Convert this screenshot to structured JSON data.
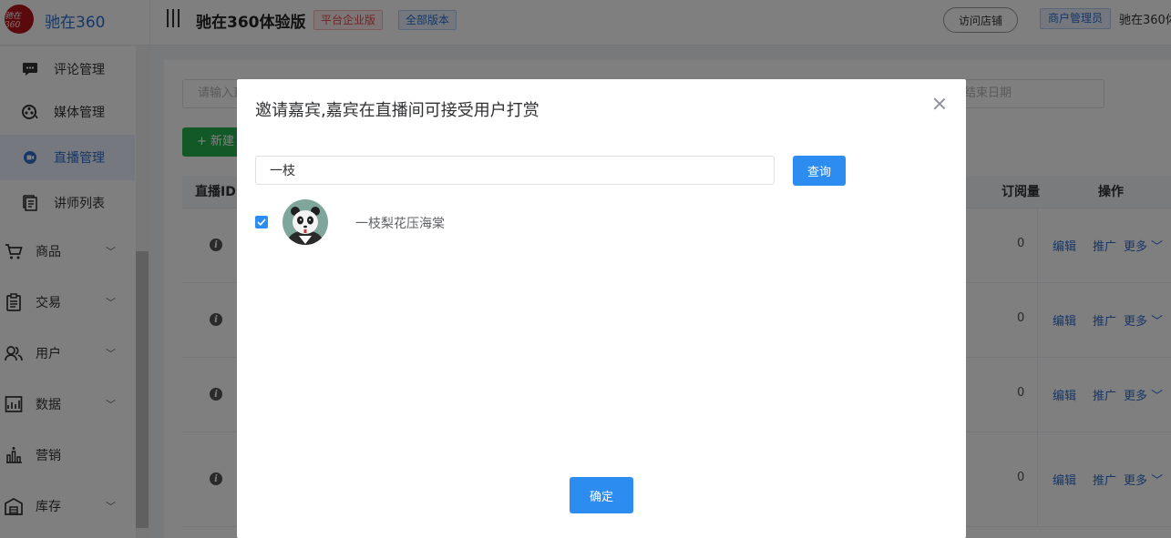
{
  "header": {
    "logo_mark": "驰在360",
    "logo_text": "驰在360",
    "site_title": "驰在360体验版",
    "edition_tag": "平台企业版",
    "version_tag": "全部版本",
    "visit_store": "访问店铺",
    "role": "商户管理员",
    "user": "驰在360体"
  },
  "sidebar": {
    "sub_items": [
      {
        "label": "评论管理",
        "icon": "comment-icon"
      },
      {
        "label": "媒体管理",
        "icon": "media-icon"
      },
      {
        "label": "直播管理",
        "icon": "live-icon",
        "active": true
      },
      {
        "label": "讲师列表",
        "icon": "list-icon"
      }
    ],
    "main_items": [
      {
        "label": "商品",
        "icon": "cart-icon"
      },
      {
        "label": "交易",
        "icon": "clipboard-icon"
      },
      {
        "label": "用户",
        "icon": "users-icon"
      },
      {
        "label": "数据",
        "icon": "chart-icon"
      },
      {
        "label": "营销",
        "icon": "marketing-icon"
      },
      {
        "label": "库存",
        "icon": "warehouse-icon"
      }
    ]
  },
  "background": {
    "filter_placeholder": "请输入直播",
    "end_date_placeholder": "结束日期",
    "new_button": "+ 新建",
    "columns": {
      "id": "直播ID",
      "subscribers": "订阅量",
      "actions": "操作"
    },
    "rows": [
      {
        "subscribers": "0"
      },
      {
        "subscribers": "0"
      },
      {
        "subscribers": "0"
      },
      {
        "subscribers": "0"
      }
    ],
    "actions": {
      "edit": "编辑",
      "promote": "推广",
      "more": "更多"
    }
  },
  "modal": {
    "title": "邀请嘉宾,嘉宾在直播间可接受用户打赏",
    "search_value": "一枝",
    "query_button": "查询",
    "results": [
      {
        "name": "一枝梨花压海棠",
        "checked": true
      }
    ],
    "confirm_button": "确定"
  }
}
